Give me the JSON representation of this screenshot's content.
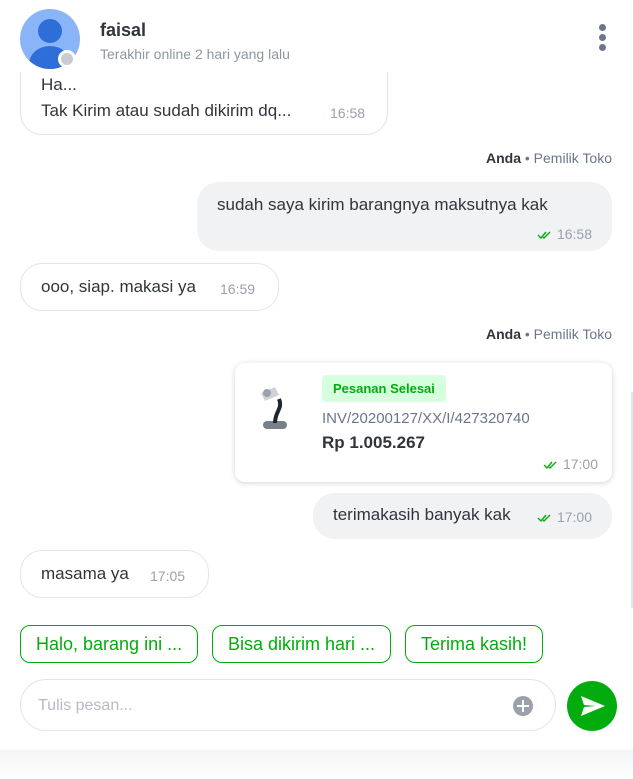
{
  "header": {
    "name": "faisal",
    "status": "Terakhir online 2 hari yang lalu"
  },
  "messages": {
    "m1": {
      "line1": "Ha...",
      "line2": "Tak Kirim atau sudah dikirim dq...",
      "time": "16:58"
    },
    "sender1": {
      "name": "Anda",
      "role": "• Pemilik Toko"
    },
    "m2": {
      "text": "sudah saya kirim barangnya maksutnya kak",
      "time": "16:58"
    },
    "m3": {
      "text": "ooo, siap. makasi ya",
      "time": "16:59"
    },
    "sender2": {
      "name": "Anda",
      "role": "• Pemilik Toko"
    },
    "order": {
      "status_badge": "Pesanan Selesai",
      "invoice": "INV/20200127/XX/I/427320740",
      "price": "Rp 1.005.267",
      "time": "17:00"
    },
    "m4": {
      "text": "terimakasih banyak kak",
      "time": "17:00"
    },
    "m5": {
      "text": "masama ya",
      "time": "17:05"
    }
  },
  "quick_replies": [
    "Halo, barang ini ...",
    "Bisa dikirim hari ...",
    "Terima kasih!"
  ],
  "composer": {
    "placeholder": "Tulis pesan..."
  },
  "icons": {
    "menu": "more-vertical-icon",
    "read_receipt": "double-check-icon",
    "attach": "plus-circle-icon",
    "send": "send-icon"
  },
  "colors": {
    "accent": "#03ac0e",
    "badge_bg": "#d6ffde",
    "avatar": "#8ab4f8"
  }
}
